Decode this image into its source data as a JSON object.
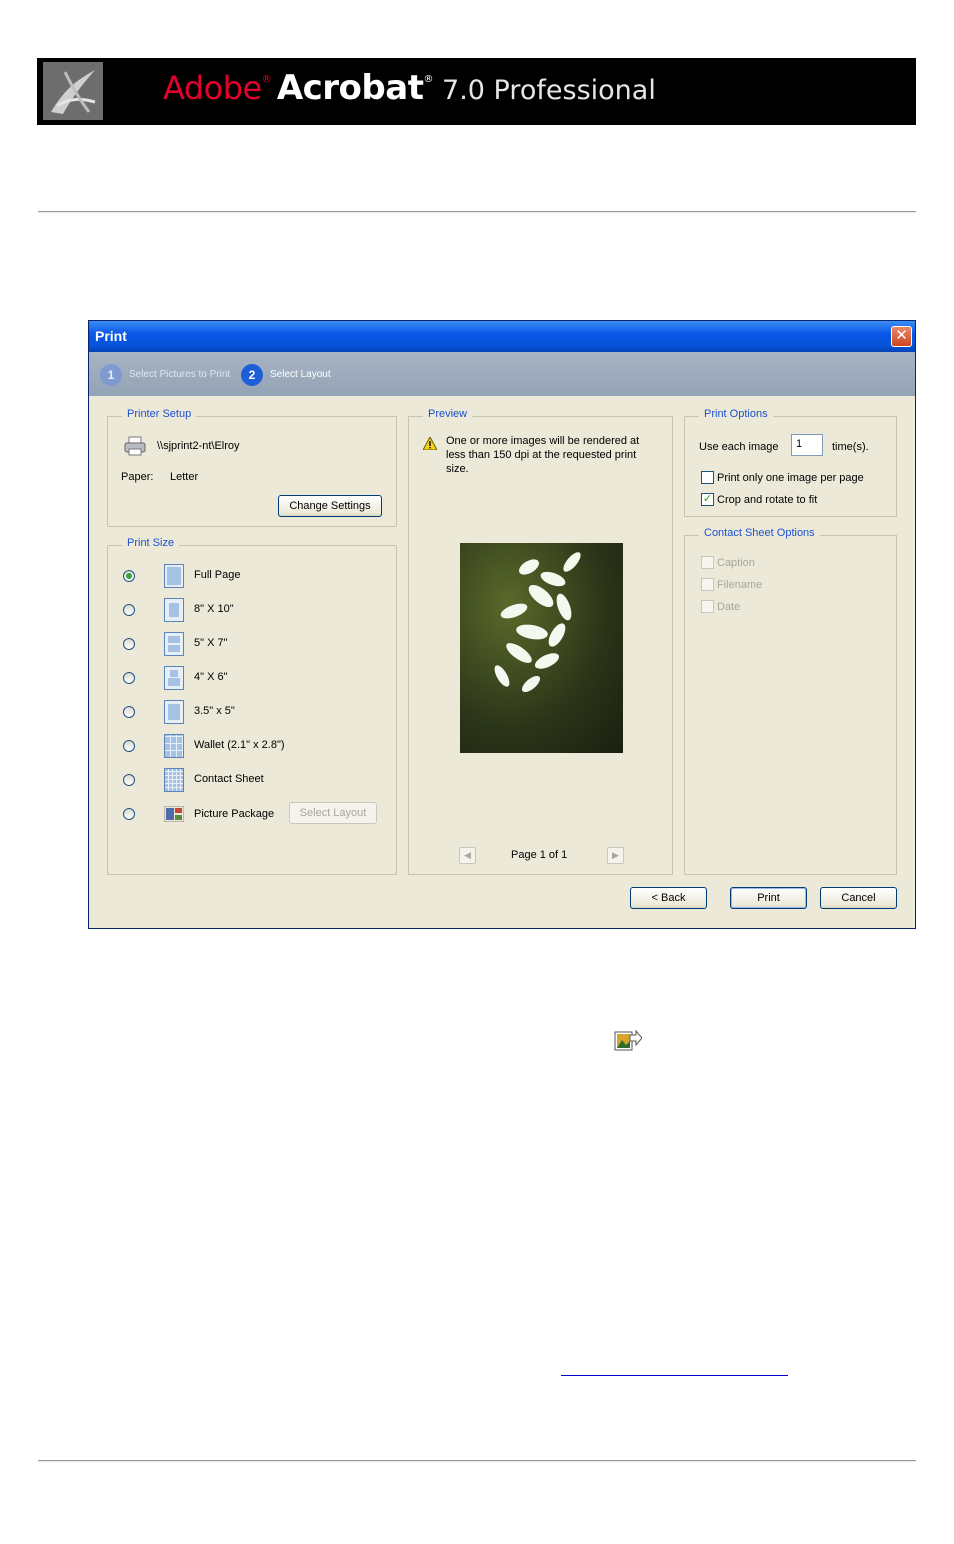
{
  "banner": {
    "brand": "Adobe",
    "reg": "®",
    "product": "Acrobat",
    "reg2": "®",
    "version": " 7.0 Professional"
  },
  "dialog": {
    "title": "Print",
    "close_glyph": "✕",
    "steps": [
      {
        "num": "1",
        "label": "Select Pictures to Print"
      },
      {
        "num": "2",
        "label": "Select Layout"
      }
    ],
    "printer_setup": {
      "legend": "Printer Setup",
      "printer_name": "\\\\sjprint2-nt\\Elroy",
      "paper_label": "Paper:",
      "paper_value": "Letter",
      "change_settings": "Change Settings"
    },
    "print_size": {
      "legend": "Print Size",
      "selected_index": 0,
      "options": [
        {
          "label": "Full Page"
        },
        {
          "label": "8\" X 10\""
        },
        {
          "label": "5\" X 7\""
        },
        {
          "label": "4\" X 6\""
        },
        {
          "label": "3.5\" x 5\""
        },
        {
          "label": "Wallet (2.1\" x 2.8\")"
        },
        {
          "label": "Contact Sheet"
        },
        {
          "label": "Picture Package"
        }
      ],
      "select_layout": "Select Layout"
    },
    "preview": {
      "legend": "Preview",
      "warning_line1": "One or more images will be rendered at",
      "warning_line2": "less than 150 dpi at the requested print",
      "warning_line3": "size.",
      "page_indicator": "Page 1 of 1"
    },
    "print_options": {
      "legend": "Print Options",
      "use_each_label": "Use each image",
      "use_each_value": "1",
      "times_label": "time(s).",
      "one_per_page_label": "Print only one image per page",
      "one_per_page_checked": false,
      "crop_rotate_label": "Crop and rotate to fit",
      "crop_rotate_checked": true
    },
    "contact_sheet": {
      "legend": "Contact Sheet Options",
      "options": [
        "Caption",
        "Filename",
        "Date"
      ]
    },
    "buttons": {
      "back": "< Back",
      "print": "Print",
      "cancel": "Cancel"
    }
  }
}
